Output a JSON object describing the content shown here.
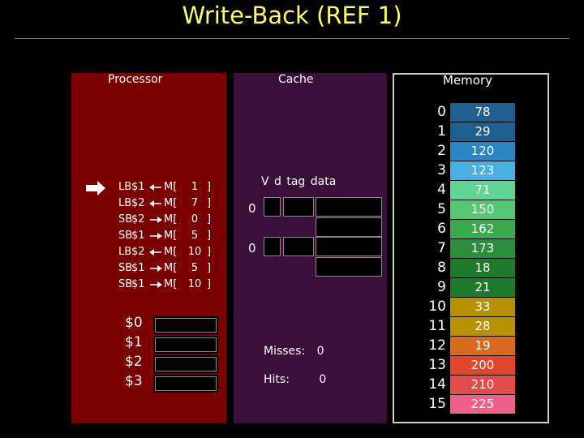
{
  "slide": {
    "title": "Write-Back (REF 1)"
  },
  "panels": {
    "processor": "Processor",
    "cache": "Cache",
    "memory": "Memory"
  },
  "instructions": [
    {
      "op": "LB",
      "reg": "$1",
      "dir": "load",
      "mem": "M[",
      "addr": "1",
      "close": "]"
    },
    {
      "op": "LB",
      "reg": "$2",
      "dir": "load",
      "mem": "M[",
      "addr": "7",
      "close": "]"
    },
    {
      "op": "SB",
      "reg": "$2",
      "dir": "store",
      "mem": "M[",
      "addr": "0",
      "close": "]"
    },
    {
      "op": "SB",
      "reg": "$1",
      "dir": "store",
      "mem": "M[",
      "addr": "5",
      "close": "]"
    },
    {
      "op": "LB",
      "reg": "$2",
      "dir": "load",
      "mem": "M[",
      "addr": "10",
      "close": "]"
    },
    {
      "op": "SB",
      "reg": "$1",
      "dir": "store",
      "mem": "M[",
      "addr": "5",
      "close": "]"
    },
    {
      "op": "SB",
      "reg": "$1",
      "dir": "store",
      "mem": "M[",
      "addr": "10",
      "close": "]"
    }
  ],
  "current_instruction": 0,
  "registers": [
    "$0",
    "$1",
    "$2",
    "$3"
  ],
  "cache": {
    "header": "V d  tag   data",
    "lines": [
      {
        "valid": "0"
      },
      {
        "valid": "0"
      }
    ],
    "misses_label": "Misses:",
    "misses_value": "0",
    "hits_label": "Hits:",
    "hits_value": "0"
  },
  "memory": [
    {
      "address": "0",
      "value": "78",
      "color": "#1f5f8f"
    },
    {
      "address": "1",
      "value": "29",
      "color": "#1f5f8f"
    },
    {
      "address": "2",
      "value": "120",
      "color": "#2a86c2"
    },
    {
      "address": "3",
      "value": "123",
      "color": "#49afe3"
    },
    {
      "address": "4",
      "value": "71",
      "color": "#5fd493"
    },
    {
      "address": "5",
      "value": "150",
      "color": "#55c774"
    },
    {
      "address": "6",
      "value": "162",
      "color": "#3aa94e"
    },
    {
      "address": "7",
      "value": "173",
      "color": "#2c8e3a"
    },
    {
      "address": "8",
      "value": "18",
      "color": "#1d7a2a"
    },
    {
      "address": "9",
      "value": "21",
      "color": "#1d7a2a"
    },
    {
      "address": "10",
      "value": "33",
      "color": "#b89100"
    },
    {
      "address": "11",
      "value": "28",
      "color": "#b89100"
    },
    {
      "address": "12",
      "value": "19",
      "color": "#d96a1e"
    },
    {
      "address": "13",
      "value": "200",
      "color": "#e0472a"
    },
    {
      "address": "14",
      "value": "210",
      "color": "#e34a4a"
    },
    {
      "address": "15",
      "value": "225",
      "color": "#ef5f8a"
    }
  ],
  "icons": {
    "pointer": "right-arrow-icon",
    "load": "left-arrow-icon",
    "store": "right-arrow-icon"
  }
}
